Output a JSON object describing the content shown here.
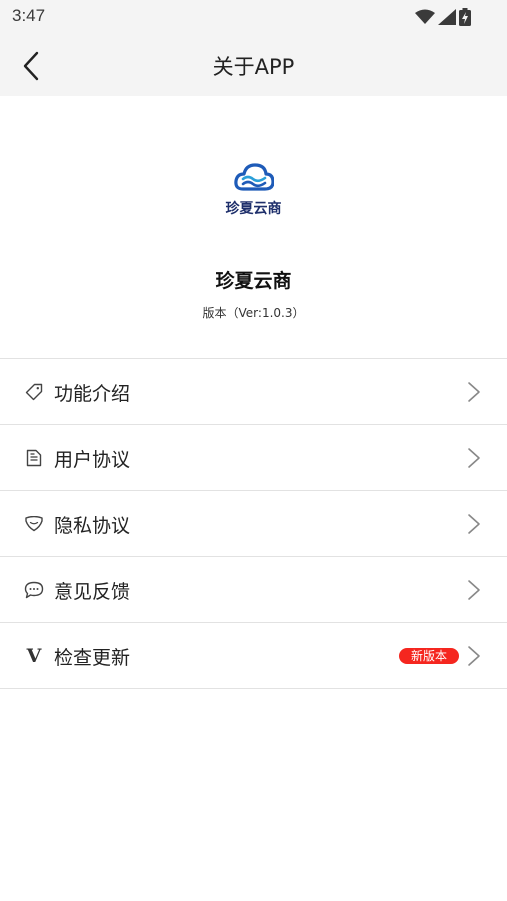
{
  "status_bar": {
    "time": "3:47"
  },
  "nav": {
    "title": "关于APP"
  },
  "logo": {
    "text": "珍夏云商",
    "brand_color": "#1e5bb8"
  },
  "app": {
    "name": "珍夏云商",
    "version": "版本（Ver:1.0.3）"
  },
  "menu": [
    {
      "label": "功能介绍",
      "icon": "tag-icon"
    },
    {
      "label": "用户协议",
      "icon": "document-icon"
    },
    {
      "label": "隐私协议",
      "icon": "shield-icon"
    },
    {
      "label": "意见反馈",
      "icon": "chat-bubble-icon"
    },
    {
      "label": "检查更新",
      "icon": "v-icon",
      "icon_text": "V",
      "badge": "新版本",
      "badge_color": "#f5261f"
    }
  ]
}
